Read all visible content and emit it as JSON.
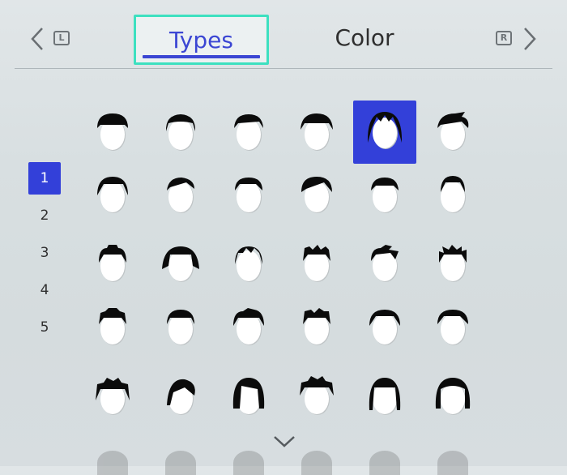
{
  "tabs": {
    "left_bumper": "L",
    "right_bumper": "R",
    "items": [
      {
        "label": "Types",
        "selected": true
      },
      {
        "label": "Color",
        "selected": false
      }
    ]
  },
  "pages": {
    "items": [
      "1",
      "2",
      "3",
      "4",
      "5"
    ],
    "selected": "1"
  },
  "hairstyles": {
    "selected_index": 4,
    "count": 30
  },
  "colors": {
    "accent": "#3340d9",
    "focus_outline": "#3de0c0",
    "tab_text_selected": "#3b46d3"
  },
  "icons": {
    "prev": "chevron-left-icon",
    "next": "chevron-right-icon",
    "scroll": "chevron-down-icon"
  }
}
